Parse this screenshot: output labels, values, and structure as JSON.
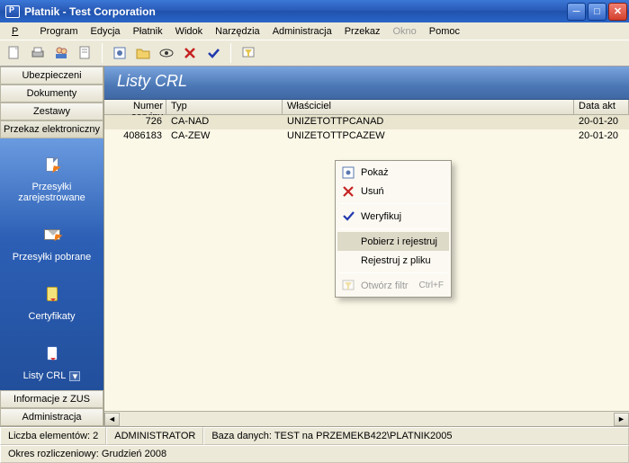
{
  "window": {
    "title": "Płatnik - Test Corporation"
  },
  "menu": {
    "program": "Program",
    "edycja": "Edycja",
    "platnik": "Płatnik",
    "widok": "Widok",
    "narzedzia": "Narzędzia",
    "administracja": "Administracja",
    "przekaz": "Przekaz",
    "okno": "Okno",
    "pomoc": "Pomoc"
  },
  "toolbar_icons": {
    "new": "new-doc-icon",
    "print": "print-icon",
    "open": "open-icon",
    "send": "send-icon",
    "folder": "folder-icon",
    "view": "view-icon",
    "delete": "delete-icon",
    "verify": "verify-icon",
    "filter": "filter-icon"
  },
  "side_buttons": {
    "ubezpieczeni": "Ubezpieczeni",
    "dokumenty": "Dokumenty",
    "zestawy": "Zestawy",
    "przekaz": "Przekaz elektroniczny",
    "informacje": "Informacje z ZUS",
    "administracja": "Administracja"
  },
  "nav_items": {
    "zarejestrowane": "Przesyłki zarejestrowane",
    "pobrane": "Przesyłki pobrane",
    "certyfikaty": "Certyfikaty",
    "listy_crl": "Listy CRL"
  },
  "banner": {
    "title": "Listy CRL"
  },
  "grid": {
    "headers": {
      "serial": "Numer seryjny",
      "type": "Typ",
      "owner": "Właściciel",
      "date": "Data akt"
    },
    "rows": [
      {
        "serial": "726",
        "type": "CA-NAD",
        "owner": "UNIZETOTTPCANAD",
        "date": "20-01-20"
      },
      {
        "serial": "4086183",
        "type": "CA-ZEW",
        "owner": "UNIZETOTTPCAZEW",
        "date": "20-01-20"
      }
    ]
  },
  "context_menu": {
    "pokaz": "Pokaż",
    "usun": "Usuń",
    "weryfikuj": "Weryfikuj",
    "pobierz": "Pobierz i rejestruj",
    "rejestruj_pliku": "Rejestruj z pliku",
    "otworz_filtr": "Otwórz filtr",
    "otworz_filtr_shortcut": "Ctrl+F"
  },
  "status": {
    "count": "Liczba elementów: 2",
    "user": "ADMINISTRATOR",
    "db": "Baza danych: TEST na PRZEMEKB422\\PLATNIK2005",
    "period": "Okres rozliczeniowy: Grudzień 2008"
  }
}
